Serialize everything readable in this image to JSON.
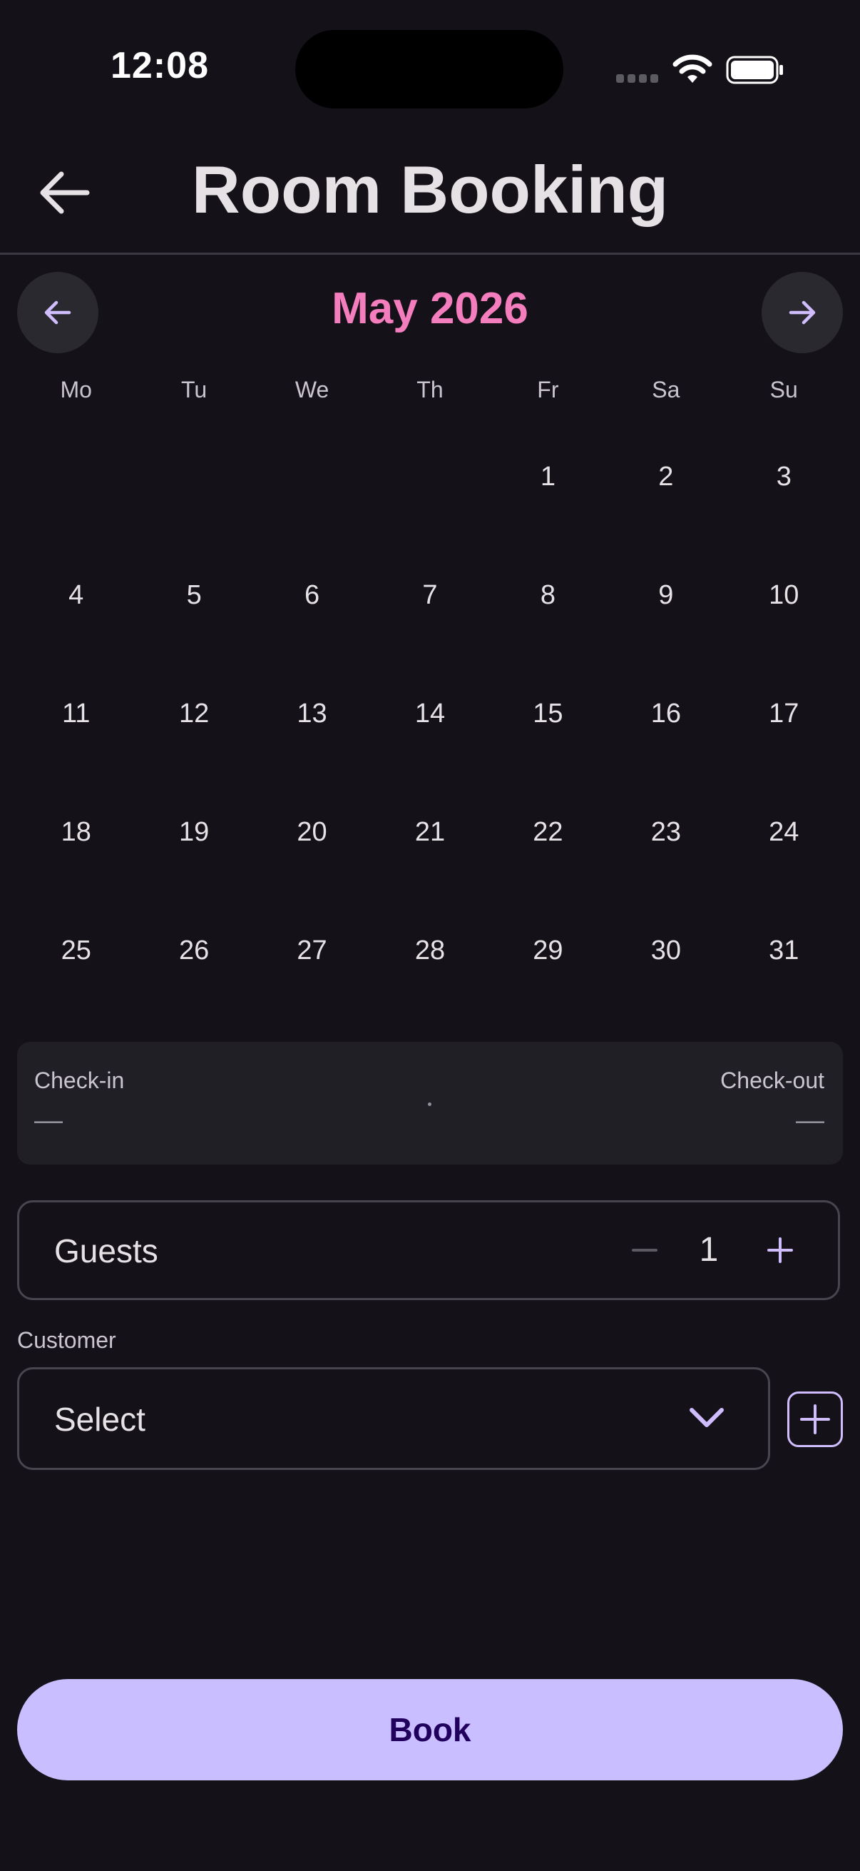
{
  "status_bar": {
    "time": "12:08"
  },
  "header": {
    "title": "Room Booking"
  },
  "calendar": {
    "month_label": "May 2026",
    "weekdays": [
      "Mo",
      "Tu",
      "We",
      "Th",
      "Fr",
      "Sa",
      "Su"
    ],
    "leading_blanks": 4,
    "days": [
      "1",
      "2",
      "3",
      "4",
      "5",
      "6",
      "7",
      "8",
      "9",
      "10",
      "11",
      "12",
      "13",
      "14",
      "15",
      "16",
      "17",
      "18",
      "19",
      "20",
      "21",
      "22",
      "23",
      "24",
      "25",
      "26",
      "27",
      "28",
      "29",
      "30",
      "31"
    ]
  },
  "date_range": {
    "checkin_label": "Check-in",
    "checkin_value": "—",
    "checkout_label": "Check-out",
    "checkout_value": "—"
  },
  "guests": {
    "label": "Guests",
    "count": "1"
  },
  "customer": {
    "label": "Customer",
    "value": "Select"
  },
  "book": {
    "label": "Book"
  },
  "colors": {
    "background": "#141218",
    "accent": "#C9BEFF",
    "month_label": "#F47DBD"
  }
}
